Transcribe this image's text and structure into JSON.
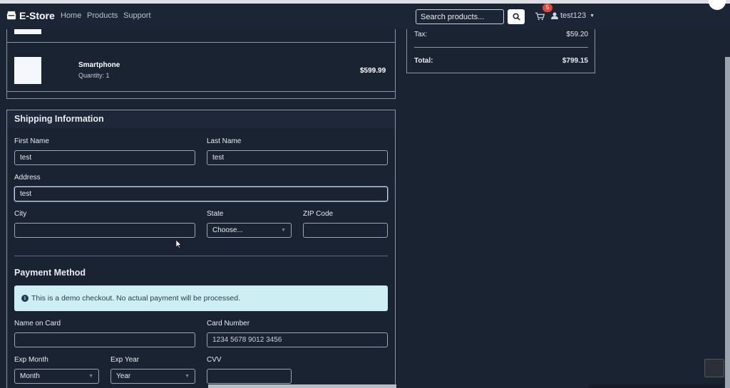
{
  "nav": {
    "brand": "E-Store",
    "links": [
      "Home",
      "Products",
      "Support"
    ],
    "search_placeholder": "Search products...",
    "cart_count": "5",
    "user": "test123"
  },
  "order_items": [
    {
      "name": "Smartphone",
      "quantity": "Quantity: 1",
      "price": "$599.99"
    }
  ],
  "summary": {
    "tax_label": "Tax:",
    "tax_value": "$59.20",
    "total_label": "Total:",
    "total_value": "$799.15"
  },
  "shipping": {
    "title": "Shipping Information",
    "first_name_label": "First Name",
    "first_name_value": "test",
    "last_name_label": "Last Name",
    "last_name_value": "test",
    "address_label": "Address",
    "address_value": "test",
    "city_label": "City",
    "city_value": "",
    "state_label": "State",
    "state_value": "Choose...",
    "zip_label": "ZIP Code",
    "zip_value": ""
  },
  "payment": {
    "title": "Payment Method",
    "notice": "This is a demo checkout. No actual payment will be processed.",
    "name_label": "Name on Card",
    "name_value": "",
    "card_label": "Card Number",
    "card_placeholder": "1234 5678 9012 3456",
    "exp_month_label": "Exp Month",
    "exp_month_value": "Month",
    "exp_year_label": "Exp Year",
    "exp_year_value": "Year",
    "cvv_label": "CVV",
    "cvv_value": ""
  },
  "colors": {
    "accent_badge": "#e0463a",
    "alert_bg": "#cdeff4",
    "page_bg": "#1a2332"
  }
}
